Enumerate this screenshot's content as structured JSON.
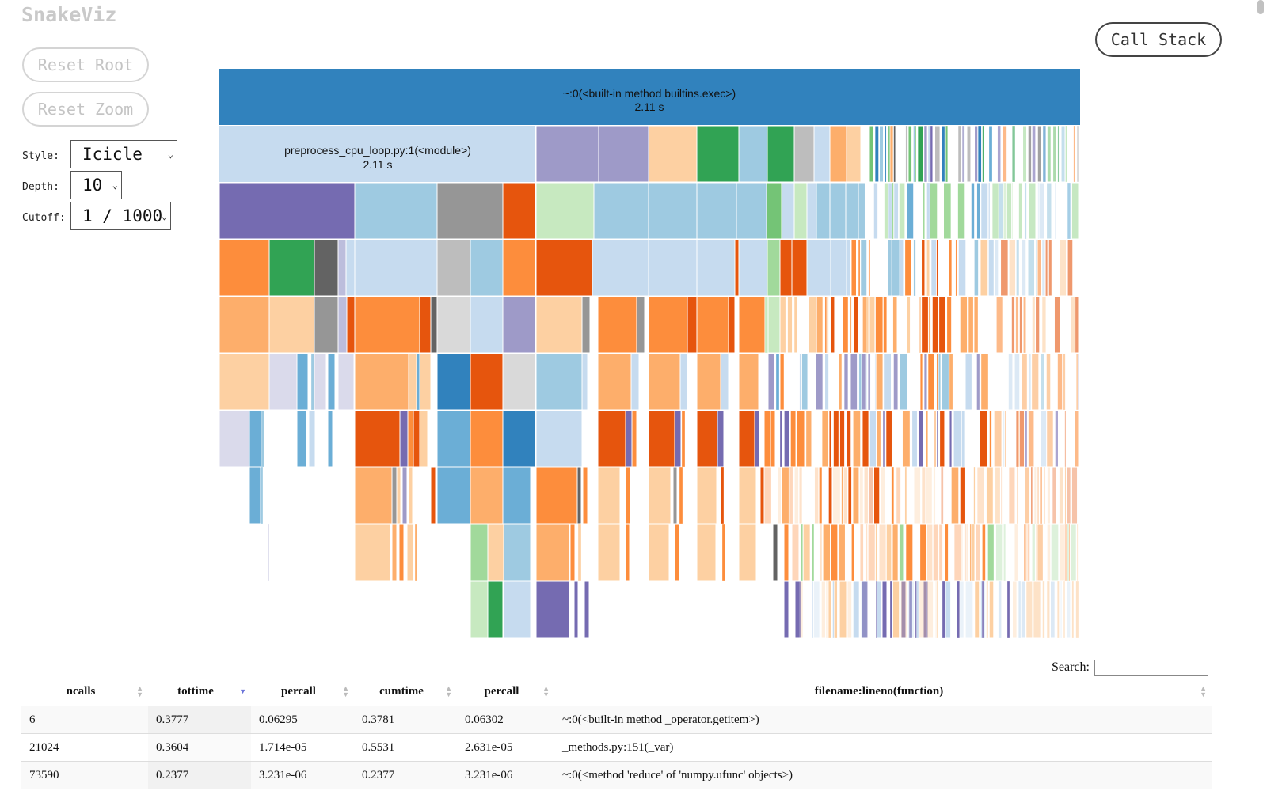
{
  "app": {
    "title": "SnakeViz"
  },
  "buttons": {
    "reset_root": "Reset Root",
    "reset_zoom": "Reset Zoom",
    "call_stack": "Call Stack"
  },
  "controls": {
    "style": {
      "label": "Style:",
      "value": "Icicle"
    },
    "depth": {
      "label": "Depth:",
      "value": "10"
    },
    "cutoff": {
      "label": "Cutoff:",
      "value": "1 / 1000"
    }
  },
  "icicle": {
    "root": {
      "name": "~:0(<built-in method builtins.exec>)",
      "time": "2.11 s",
      "color": "#3182bd"
    },
    "module": {
      "name": "preprocess_cpu_loop.py:1(<module>)",
      "time": "2.11 s",
      "color": "#c6dbef"
    }
  },
  "search": {
    "label": "Search:",
    "value": ""
  },
  "table": {
    "columns": [
      "ncalls",
      "tottime",
      "percall",
      "cumtime",
      "percall",
      "filename:lineno(function)"
    ],
    "sorted_column": "tottime",
    "rows": [
      [
        "6",
        "0.3777",
        "0.06295",
        "0.3781",
        "0.06302",
        "~:0(<built-in method _operator.getitem>)"
      ],
      [
        "21024",
        "0.3604",
        "1.714e-05",
        "0.5531",
        "2.631e-05",
        "_methods.py:151(_var)"
      ],
      [
        "73590",
        "0.2377",
        "3.231e-06",
        "0.2377",
        "3.231e-06",
        "~:0(<method 'reduce' of 'numpy.ufunc' objects>)"
      ]
    ]
  }
}
